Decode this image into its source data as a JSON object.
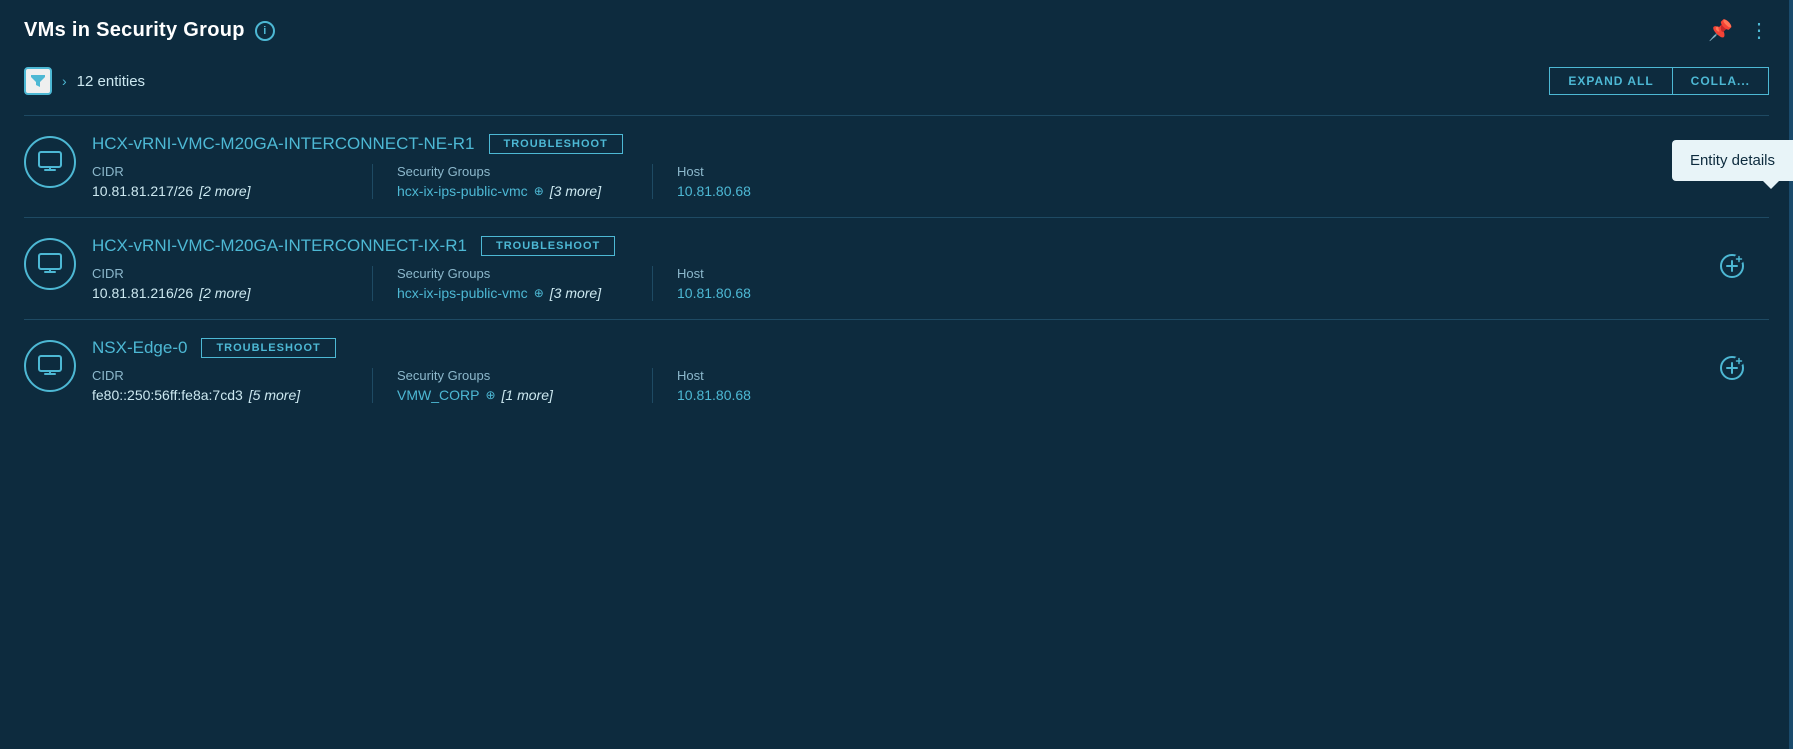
{
  "panel": {
    "title": "VMs in Security Group",
    "info_icon": "i",
    "entities_count": "12 entities"
  },
  "header_actions": {
    "pin_label": "📌",
    "more_label": "⋮"
  },
  "filter_bar": {
    "filter_icon": "▽",
    "expand_chevron": "›",
    "entities_count_label": "12 entities",
    "expand_all_label": "EXPAND ALL",
    "collapse_label": "COLLA..."
  },
  "tooltip": {
    "label": "Entity details"
  },
  "entities": [
    {
      "id": 1,
      "name": "HCX-vRNI-VMC-M20GA-INTERCONNECT-NE-R1",
      "troubleshoot_label": "TROUBLESHOOT",
      "cidr_label": "CIDR",
      "cidr_value": "10.81.81.217/26",
      "cidr_more": "[2 more]",
      "security_groups_label": "Security Groups",
      "security_groups_value": "hcx-ix-ips-public-vmc",
      "security_groups_more": "[3 more]",
      "host_label": "Host",
      "host_value": "10.81.80.68"
    },
    {
      "id": 2,
      "name": "HCX-vRNI-VMC-M20GA-INTERCONNECT-IX-R1",
      "troubleshoot_label": "TROUBLESHOOT",
      "cidr_label": "CIDR",
      "cidr_value": "10.81.81.216/26",
      "cidr_more": "[2 more]",
      "security_groups_label": "Security Groups",
      "security_groups_value": "hcx-ix-ips-public-vmc",
      "security_groups_more": "[3 more]",
      "host_label": "Host",
      "host_value": "10.81.80.68"
    },
    {
      "id": 3,
      "name": "NSX-Edge-0",
      "troubleshoot_label": "TROUBLESHOOT",
      "cidr_label": "CIDR",
      "cidr_value": "fe80::250:56ff:fe8a:7cd3",
      "cidr_more": "[5 more]",
      "security_groups_label": "Security Groups",
      "security_groups_value": "VMW_CORP",
      "security_groups_more": "[1 more]",
      "host_label": "Host",
      "host_value": "10.81.80.68"
    }
  ]
}
